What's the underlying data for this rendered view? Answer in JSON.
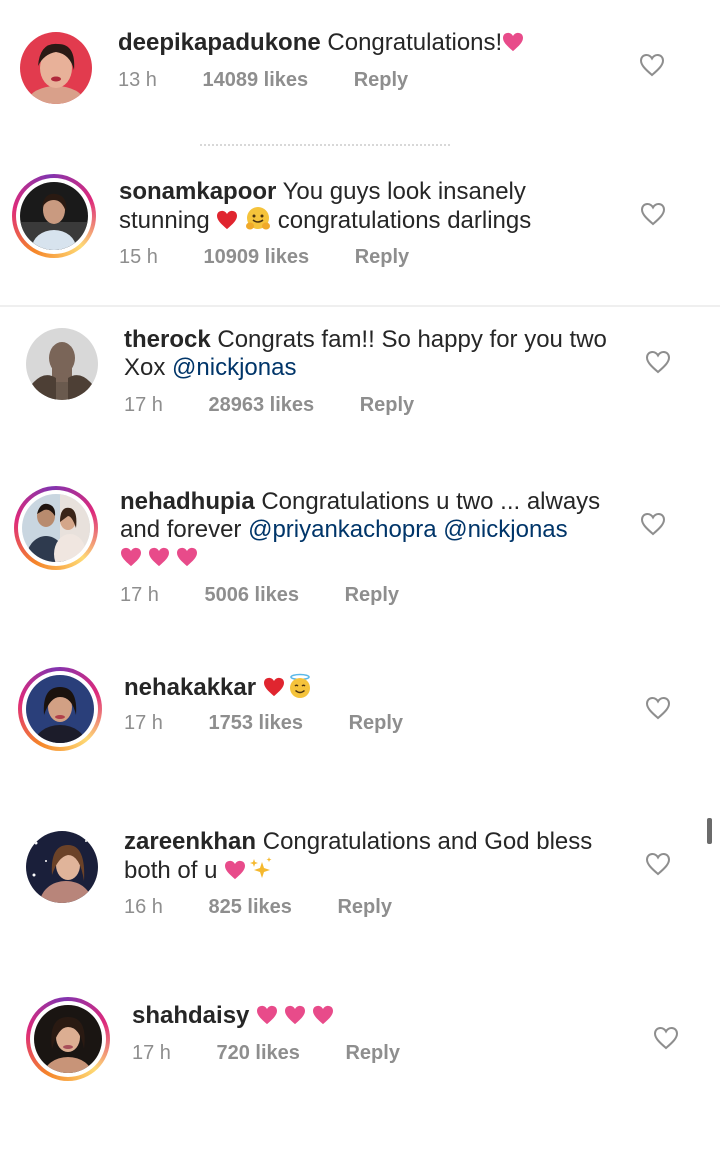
{
  "comments": [
    {
      "username": "deepikapadukone",
      "text": "Congratulations!",
      "emoji_after": [
        "pink-heart"
      ],
      "time": "13 h",
      "likes": "14089 likes",
      "reply": "Reply",
      "has_story_ring": false
    },
    {
      "username": "sonamkapoor",
      "text_line1": "You guys look insanely",
      "text_line2_pre": "stunning",
      "text_line2_post": "congratulations darlings",
      "time": "15 h",
      "likes": "10909 likes",
      "reply": "Reply",
      "has_story_ring": true
    },
    {
      "username": "therock",
      "text_line1": "Congrats fam!! So happy for you two",
      "text_line2_pre": "Xox",
      "mention": "@nickjonas",
      "time": "17 h",
      "likes": "28963 likes",
      "reply": "Reply",
      "has_story_ring": false
    },
    {
      "username": "nehadhupia",
      "text_line1": "Congratulations u two ... always",
      "text_line2_pre": "and forever",
      "mention1": "@priyankachopra",
      "mention2": "@nickjonas",
      "time": "17 h",
      "likes": "5006 likes",
      "reply": "Reply",
      "has_story_ring": true
    },
    {
      "username": "nehakakkar",
      "time": "17 h",
      "likes": "1753 likes",
      "reply": "Reply",
      "has_story_ring": true
    },
    {
      "username": "zareenkhan",
      "text_line1": "Congratulations and God bless",
      "text_line2_pre": "both of u",
      "time": "16 h",
      "likes": "825 likes",
      "reply": "Reply",
      "has_story_ring": false
    },
    {
      "username": "shahdaisy",
      "time": "17 h",
      "likes": "720 likes",
      "reply": "Reply",
      "has_story_ring": true
    }
  ],
  "colors": {
    "text": "#262626",
    "meta": "#8e8e8e",
    "mention": "#003569",
    "heart_emoji": "#e84b8a",
    "red_heart": "#e0252f"
  },
  "icons": {
    "like": "heart-outline-icon"
  }
}
